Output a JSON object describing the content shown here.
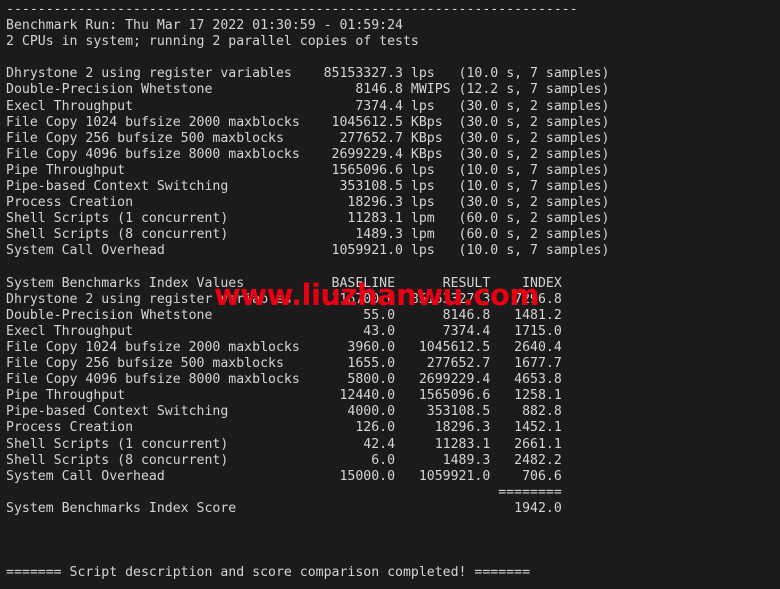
{
  "terminal": {
    "background": "#1b1b1b",
    "foreground": "#d4d4d4",
    "top_rule": "------------------------------------------------------------------------",
    "header": {
      "benchmark_run": "Benchmark Run: Thu Mar 17 2022 01:30:59 - 01:59:24",
      "cpu_line": "2 CPUs in system; running 2 parallel copies of tests"
    },
    "raw_results": [
      {
        "name": "Dhrystone 2 using register variables",
        "value": "85153327.3",
        "unit": "lps",
        "timing": "(10.0 s, 7 samples)"
      },
      {
        "name": "Double-Precision Whetstone",
        "value": "8146.8",
        "unit": "MWIPS",
        "timing": "(12.2 s, 7 samples)"
      },
      {
        "name": "Execl Throughput",
        "value": "7374.4",
        "unit": "lps",
        "timing": "(30.0 s, 2 samples)"
      },
      {
        "name": "File Copy 1024 bufsize 2000 maxblocks",
        "value": "1045612.5",
        "unit": "KBps",
        "timing": "(30.0 s, 2 samples)"
      },
      {
        "name": "File Copy 256 bufsize 500 maxblocks",
        "value": "277652.7",
        "unit": "KBps",
        "timing": "(30.0 s, 2 samples)"
      },
      {
        "name": "File Copy 4096 bufsize 8000 maxblocks",
        "value": "2699229.4",
        "unit": "KBps",
        "timing": "(30.0 s, 2 samples)"
      },
      {
        "name": "Pipe Throughput",
        "value": "1565096.6",
        "unit": "lps",
        "timing": "(10.0 s, 7 samples)"
      },
      {
        "name": "Pipe-based Context Switching",
        "value": "353108.5",
        "unit": "lps",
        "timing": "(10.0 s, 7 samples)"
      },
      {
        "name": "Process Creation",
        "value": "18296.3",
        "unit": "lps",
        "timing": "(30.0 s, 2 samples)"
      },
      {
        "name": "Shell Scripts (1 concurrent)",
        "value": "11283.1",
        "unit": "lpm",
        "timing": "(60.0 s, 2 samples)"
      },
      {
        "name": "Shell Scripts (8 concurrent)",
        "value": "1489.3",
        "unit": "lpm",
        "timing": "(60.0 s, 2 samples)"
      },
      {
        "name": "System Call Overhead",
        "value": "1059921.0",
        "unit": "lps",
        "timing": "(10.0 s, 7 samples)"
      }
    ],
    "index_table": {
      "title": "System Benchmarks Index Values",
      "columns": [
        "BASELINE",
        "RESULT",
        "INDEX"
      ],
      "rows": [
        {
          "name": "Dhrystone 2 using register variables",
          "baseline": "116700.0",
          "result": "85153327.3",
          "index": "7296.8"
        },
        {
          "name": "Double-Precision Whetstone",
          "baseline": "55.0",
          "result": "8146.8",
          "index": "1481.2"
        },
        {
          "name": "Execl Throughput",
          "baseline": "43.0",
          "result": "7374.4",
          "index": "1715.0"
        },
        {
          "name": "File Copy 1024 bufsize 2000 maxblocks",
          "baseline": "3960.0",
          "result": "1045612.5",
          "index": "2640.4"
        },
        {
          "name": "File Copy 256 bufsize 500 maxblocks",
          "baseline": "1655.0",
          "result": "277652.7",
          "index": "1677.7"
        },
        {
          "name": "File Copy 4096 bufsize 8000 maxblocks",
          "baseline": "5800.0",
          "result": "2699229.4",
          "index": "4653.8"
        },
        {
          "name": "Pipe Throughput",
          "baseline": "12440.0",
          "result": "1565096.6",
          "index": "1258.1"
        },
        {
          "name": "Pipe-based Context Switching",
          "baseline": "4000.0",
          "result": "353108.5",
          "index": "882.8"
        },
        {
          "name": "Process Creation",
          "baseline": "126.0",
          "result": "18296.3",
          "index": "1452.1"
        },
        {
          "name": "Shell Scripts (1 concurrent)",
          "baseline": "42.4",
          "result": "11283.1",
          "index": "2661.1"
        },
        {
          "name": "Shell Scripts (8 concurrent)",
          "baseline": "6.0",
          "result": "1489.3",
          "index": "2482.2"
        },
        {
          "name": "System Call Overhead",
          "baseline": "15000.0",
          "result": "1059921.0",
          "index": "706.6"
        }
      ],
      "separator": "========",
      "score_label": "System Benchmarks Index Score",
      "score_value": "1942.0"
    },
    "footer": "======= Script description and score comparison completed! ======="
  },
  "watermark": {
    "text": "www.liuzhanwu.com",
    "color": "#e70012"
  }
}
